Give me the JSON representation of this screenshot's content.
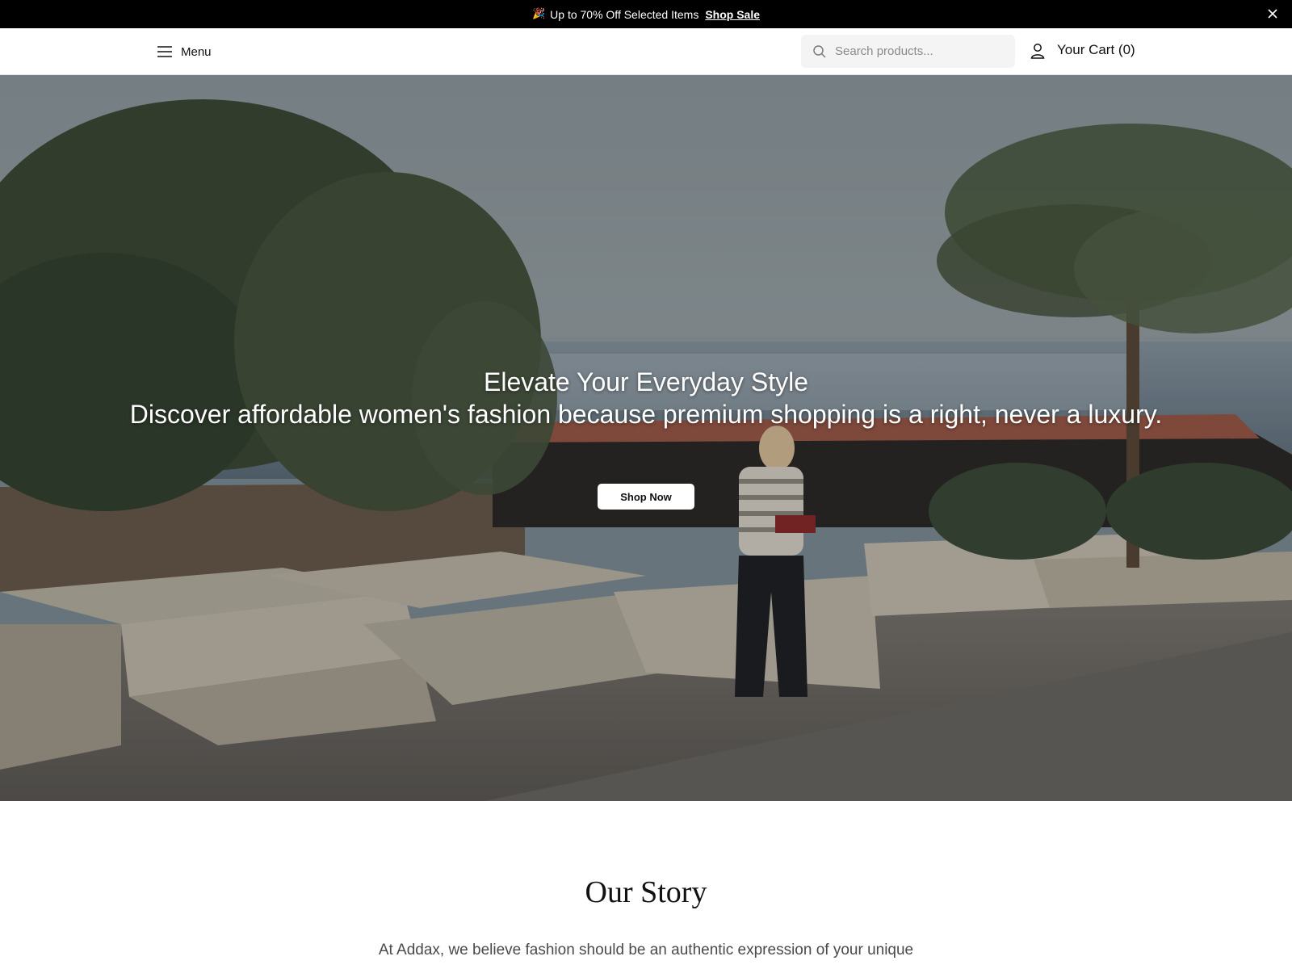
{
  "announcement": {
    "emoji": "🎉",
    "text": "Up to 70% Off Selected Items",
    "link_label": "Shop Sale",
    "close_icon": "close-icon"
  },
  "header": {
    "menu_label": "Menu",
    "menu_icon": "hamburger-icon",
    "search_placeholder": "Search products...",
    "search_icon": "search-icon",
    "account_icon": "user-icon",
    "cart_label": "Your Cart (0)"
  },
  "hero": {
    "title": "Elevate Your Everyday Style",
    "subtitle": "Discover affordable women's fashion because premium shopping is a right, never a luxury.",
    "cta_label": "Shop Now"
  },
  "story": {
    "title": "Our Story",
    "text": "At Addax, we believe fashion should be an authentic expression of your unique"
  },
  "colors": {
    "announcement_bg": "#000000",
    "search_bg": "#f4f4f4",
    "cta_bg": "#ffffff",
    "story_text": "#4a4a4a"
  }
}
